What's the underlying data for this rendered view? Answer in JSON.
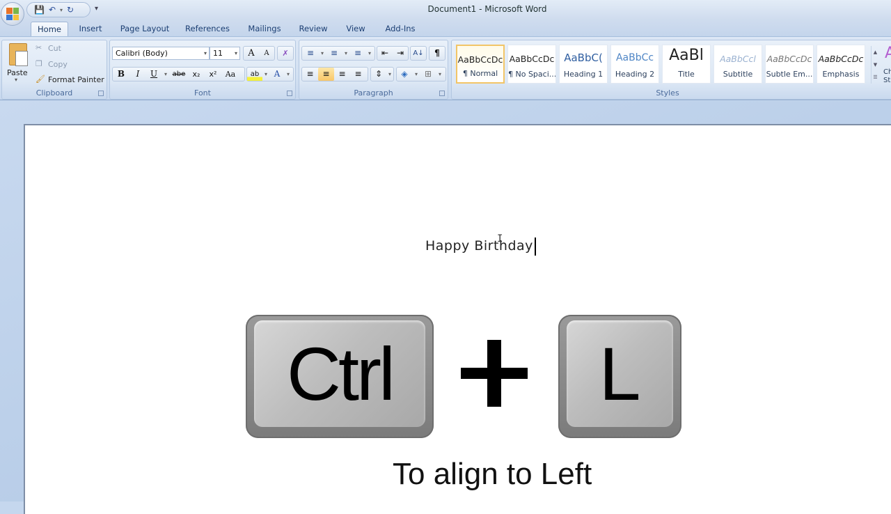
{
  "window": {
    "title": "Document1 - Microsoft Word"
  },
  "qat": {
    "save_icon": "save-icon",
    "undo_icon": "undo-icon",
    "redo_icon": "redo-icon",
    "customize_icon": "customize-qat-icon"
  },
  "tabs": [
    {
      "label": "Home",
      "active": true
    },
    {
      "label": "Insert"
    },
    {
      "label": "Page Layout"
    },
    {
      "label": "References"
    },
    {
      "label": "Mailings"
    },
    {
      "label": "Review"
    },
    {
      "label": "View"
    },
    {
      "label": "Add-Ins"
    }
  ],
  "clipboard": {
    "paste_label": "Paste",
    "cut_label": "Cut",
    "copy_label": "Copy",
    "format_painter_label": "Format Painter",
    "group_label": "Clipboard"
  },
  "font": {
    "font_name": "Calibri (Body)",
    "font_size": "11",
    "group_label": "Font",
    "bold": "B",
    "italic": "I",
    "underline": "U",
    "strikethrough": "abe",
    "subscript": "x₂",
    "superscript": "x²",
    "change_case": "Aa",
    "grow": "A",
    "shrink": "A",
    "font_color": "A"
  },
  "paragraph": {
    "group_label": "Paragraph",
    "active_alignment": "center"
  },
  "styles": {
    "group_label": "Styles",
    "items": [
      {
        "sample": "AaBbCcDc",
        "name": "¶ Normal",
        "selected": true
      },
      {
        "sample": "AaBbCcDc",
        "name": "¶ No Spaci..."
      },
      {
        "sample": "AaBbC(",
        "name": "Heading 1"
      },
      {
        "sample": "AaBbCc",
        "name": "Heading 2"
      },
      {
        "sample": "AaBl",
        "name": "Title"
      },
      {
        "sample": "AaBbCcl",
        "name": "Subtitle"
      },
      {
        "sample": "AaBbCcDc",
        "name": "Subtle Em..."
      },
      {
        "sample": "AaBbCcDc",
        "name": "Emphasis"
      }
    ],
    "change_styles_label": "Ch St"
  },
  "document": {
    "text": "Happy Birthday"
  },
  "overlay": {
    "key1": "Ctrl",
    "plus": "+",
    "key2": "L",
    "caption": "To align to Left"
  }
}
